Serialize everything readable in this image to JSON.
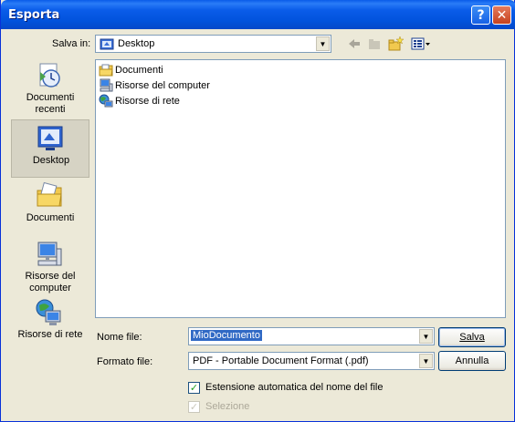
{
  "window": {
    "title": "Esporta"
  },
  "titlebar": {
    "help_glyph": "?",
    "close_glyph": "✕"
  },
  "lookin": {
    "label": "Salva in:",
    "value": "Desktop"
  },
  "places": [
    {
      "label_line1": "Documenti",
      "label_line2": "recenti",
      "icon": "recent-documents-icon"
    },
    {
      "label_line1": "Desktop",
      "label_line2": "",
      "icon": "desktop-icon"
    },
    {
      "label_line1": "Documenti",
      "label_line2": "",
      "icon": "my-documents-icon"
    },
    {
      "label_line1": "Risorse del",
      "label_line2": "computer",
      "icon": "my-computer-icon"
    },
    {
      "label_line1": "Risorse di rete",
      "label_line2": "",
      "icon": "network-places-icon"
    }
  ],
  "files": [
    {
      "name": "Documenti",
      "icon": "folder-icon"
    },
    {
      "name": "Risorse del computer",
      "icon": "computer-icon"
    },
    {
      "name": "Risorse di rete",
      "icon": "network-icon"
    }
  ],
  "filename": {
    "label": "Nome file:",
    "value": "MioDocumento"
  },
  "format": {
    "label": "Formato file:",
    "value": "PDF - Portable Document Format (.pdf)"
  },
  "buttons": {
    "save": "Salva",
    "cancel": "Annulla"
  },
  "options": {
    "auto_ext": {
      "label": "Estensione automatica del nome del file",
      "checked": true
    },
    "selection": {
      "label": "Selezione",
      "checked": true,
      "disabled": true
    }
  },
  "colors": {
    "title_blue": "#0a5ce9",
    "dialog_bg": "#ece9d8",
    "selection": "#316ac5"
  }
}
